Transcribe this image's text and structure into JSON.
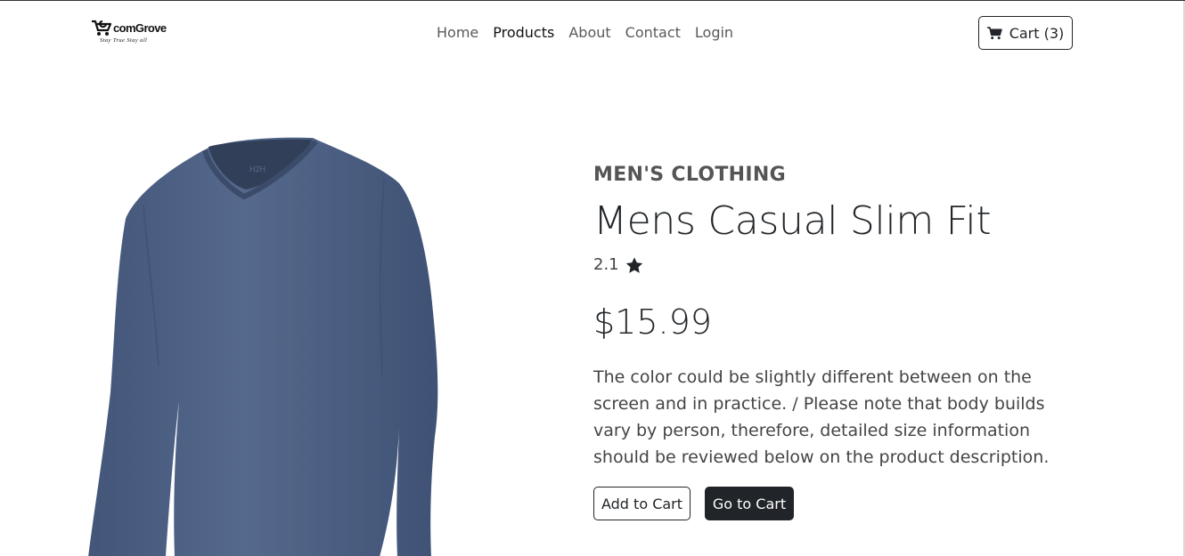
{
  "brand": {
    "name": "comGrove",
    "tagline": "Stay True Stay all"
  },
  "nav": {
    "items": [
      {
        "label": "Home",
        "active": false
      },
      {
        "label": "Products",
        "active": true
      },
      {
        "label": "About",
        "active": false
      },
      {
        "label": "Contact",
        "active": false
      },
      {
        "label": "Login",
        "active": false
      }
    ]
  },
  "cart": {
    "label": "Cart (3)",
    "icon": "shopping-cart-icon"
  },
  "product": {
    "category": "MEN'S CLOTHING",
    "title": "Mens Casual Slim Fit",
    "rating": "2.1",
    "rating_icon": "star-icon",
    "price": "$15.99",
    "description": "The color could be slightly different between on the screen and in practice. / Please note that body builds vary by person, therefore, detailed size information should be reviewed below on the product description.",
    "image_label": "H2H",
    "image_color": "#4d5f80"
  },
  "actions": {
    "add_to_cart": "Add to Cart",
    "go_to_cart": "Go to Cart"
  }
}
